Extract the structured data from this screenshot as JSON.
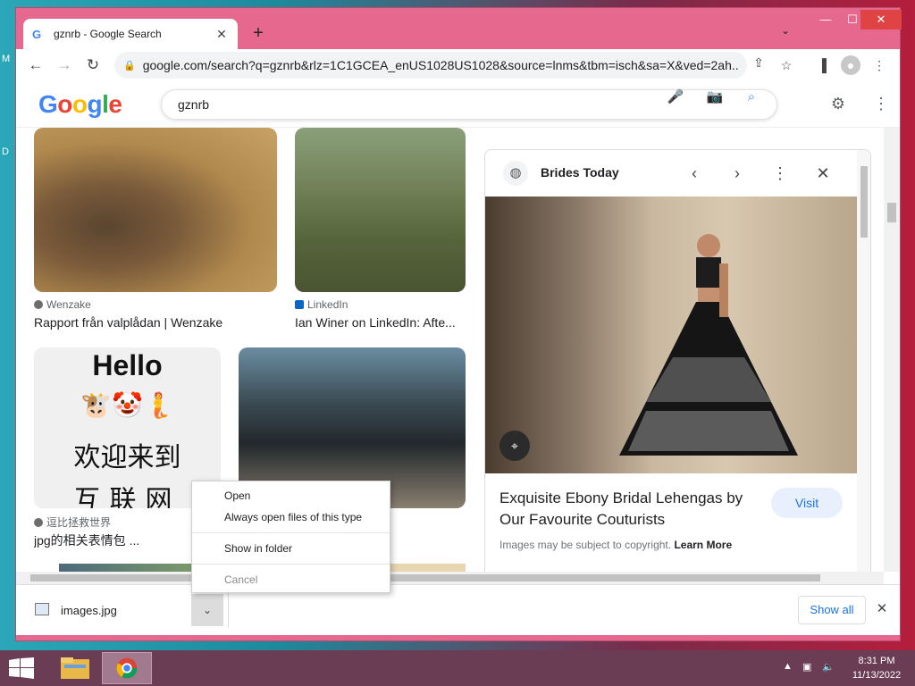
{
  "desktop": {
    "fragments": [
      "M",
      "D"
    ]
  },
  "browser": {
    "tab_title": "gznrb - Google Search",
    "tab_favicon": "G",
    "url": "google.com/search?q=gznrb&rlz=1C1GCEA_enUS1028US1028&source=lnms&tbm=isch&sa=X&ved=2ah..."
  },
  "search": {
    "query": "gznrb",
    "logo": [
      "G",
      "o",
      "o",
      "g",
      "l",
      "e"
    ]
  },
  "results": [
    {
      "source": "Wenzake",
      "caption": "Rapport från valplådan | Wenzake"
    },
    {
      "source": "LinkedIn",
      "caption": "Ian Winer on LinkedIn: Afte..."
    },
    {
      "source": "逗比拯救世界",
      "caption": "jpg的相关表情包 ..."
    }
  ],
  "hello_image": {
    "word": "Hello",
    "emoji": "🐮🤡🧜",
    "line1": "欢迎来到",
    "line2": "互联网"
  },
  "panel": {
    "site": "Brides Today",
    "heading": "Exquisite Ebony Bridal Lehengas by Our Favourite Couturists",
    "visit": "Visit",
    "copyright": "Images may be subject to copyright.",
    "learn_more": "Learn More"
  },
  "download": {
    "filename": "images.jpg",
    "show_all": "Show all"
  },
  "context_menu": {
    "open": "Open",
    "always_open": "Always open files of this type",
    "show_in_folder": "Show in folder",
    "cancel": "Cancel"
  },
  "taskbar": {
    "time": "8:31 PM",
    "date": "11/13/2022"
  },
  "colors": {
    "window_frame": "#e7688f",
    "accent_blue": "#1a73e8",
    "taskbar": "#6b3d54"
  }
}
